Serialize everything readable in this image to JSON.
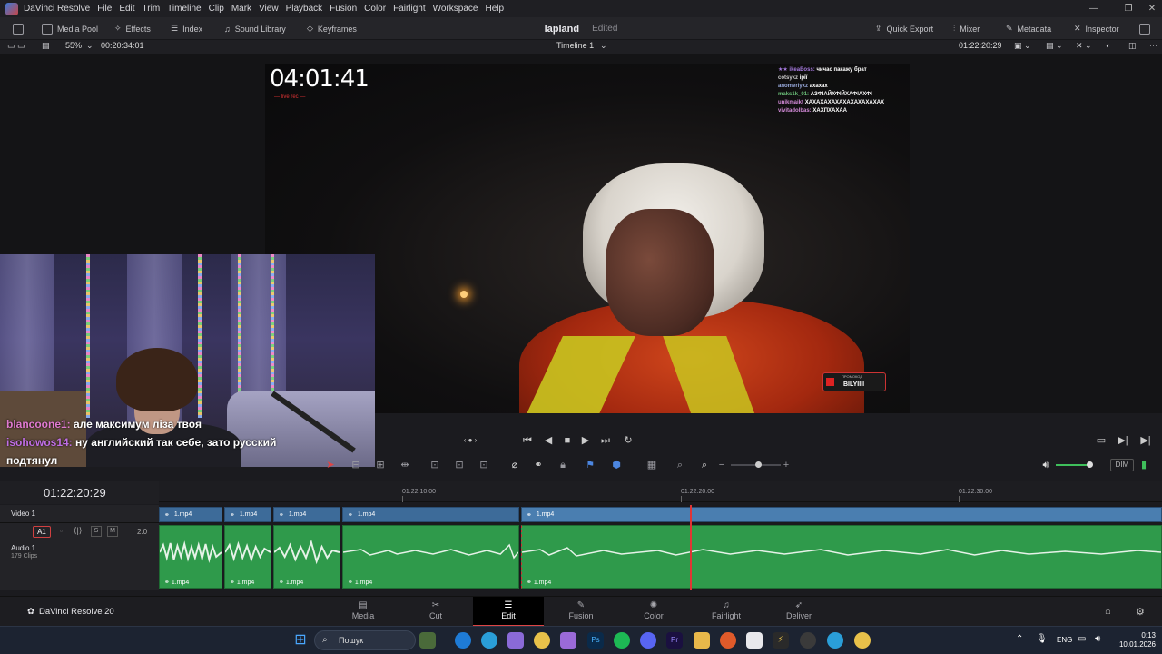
{
  "app": {
    "menu": [
      "DaVinci Resolve",
      "File",
      "Edit",
      "Trim",
      "Timeline",
      "Clip",
      "Mark",
      "View",
      "Playback",
      "Fusion",
      "Color",
      "Fairlight",
      "Workspace",
      "Help"
    ]
  },
  "toolbar": {
    "media_pool": "Media Pool",
    "effects": "Effects",
    "index": "Index",
    "sound_library": "Sound Library",
    "keyframes": "Keyframes",
    "project_name": "lapland",
    "project_state": "Edited",
    "quick_export": "Quick Export",
    "mixer": "Mixer",
    "metadata": "Metadata",
    "inspector": "Inspector"
  },
  "viewerbar": {
    "zoom": "55%",
    "source_tc": "00:20:34:01",
    "timeline_name": "Timeline 1",
    "record_tc": "01:22:20:29"
  },
  "overlay": {
    "timer": "04:01:41",
    "timer_sub": "— live rec —",
    "chat": [
      {
        "user": "★★ ikeaBoss:",
        "msg": "чичас пакажу брат"
      },
      {
        "user": "cotsykz",
        "msg": "ірії"
      },
      {
        "user": "anomerlyxz",
        "msg": "ахахах"
      },
      {
        "user": "maks1k_01:",
        "msg": "АЗФІАЙХФІЙХАФІАХФІ"
      },
      {
        "user": "unikmaikt",
        "msg": "ХАХАХАХАХАХАХАХАХАХАХ"
      },
      {
        "user": "vivitadolbas:",
        "msg": "ХАХПХАХАА"
      }
    ],
    "promo_label": "ПРОМОКОД",
    "promo_code": "BILYIIII"
  },
  "viewer_chat": [
    {
      "user": "blancoone1:",
      "msg": " але максимум ліза твоя"
    },
    {
      "user": "isohowos14:",
      "msg": " ну английский так себе, зато русский подтянул"
    }
  ],
  "timeline": {
    "timecode": "01:22:20:29",
    "ruler": [
      "01:22:10:00",
      "01:22:20:00",
      "01:22:30:00"
    ],
    "video_track": "Video 1",
    "audio_track": "Audio 1",
    "audio_badge": "A1",
    "audio_clips_count": "179 Clips",
    "audio_level": "2.0",
    "clip_name": "1.mp4",
    "dim": "DIM"
  },
  "pages": [
    "Media",
    "Cut",
    "Edit",
    "Fusion",
    "Color",
    "Fairlight",
    "Deliver"
  ],
  "active_page": "Edit",
  "brand": "DaVinci Resolve 20",
  "taskbar": {
    "search": "Пошук",
    "lang": "ENG",
    "time": "0:13",
    "date": "10.01.2026"
  },
  "colors": {
    "video_clip": "#3d6b99",
    "audio_clip": "#2f9a4b",
    "playhead": "#e03535"
  }
}
